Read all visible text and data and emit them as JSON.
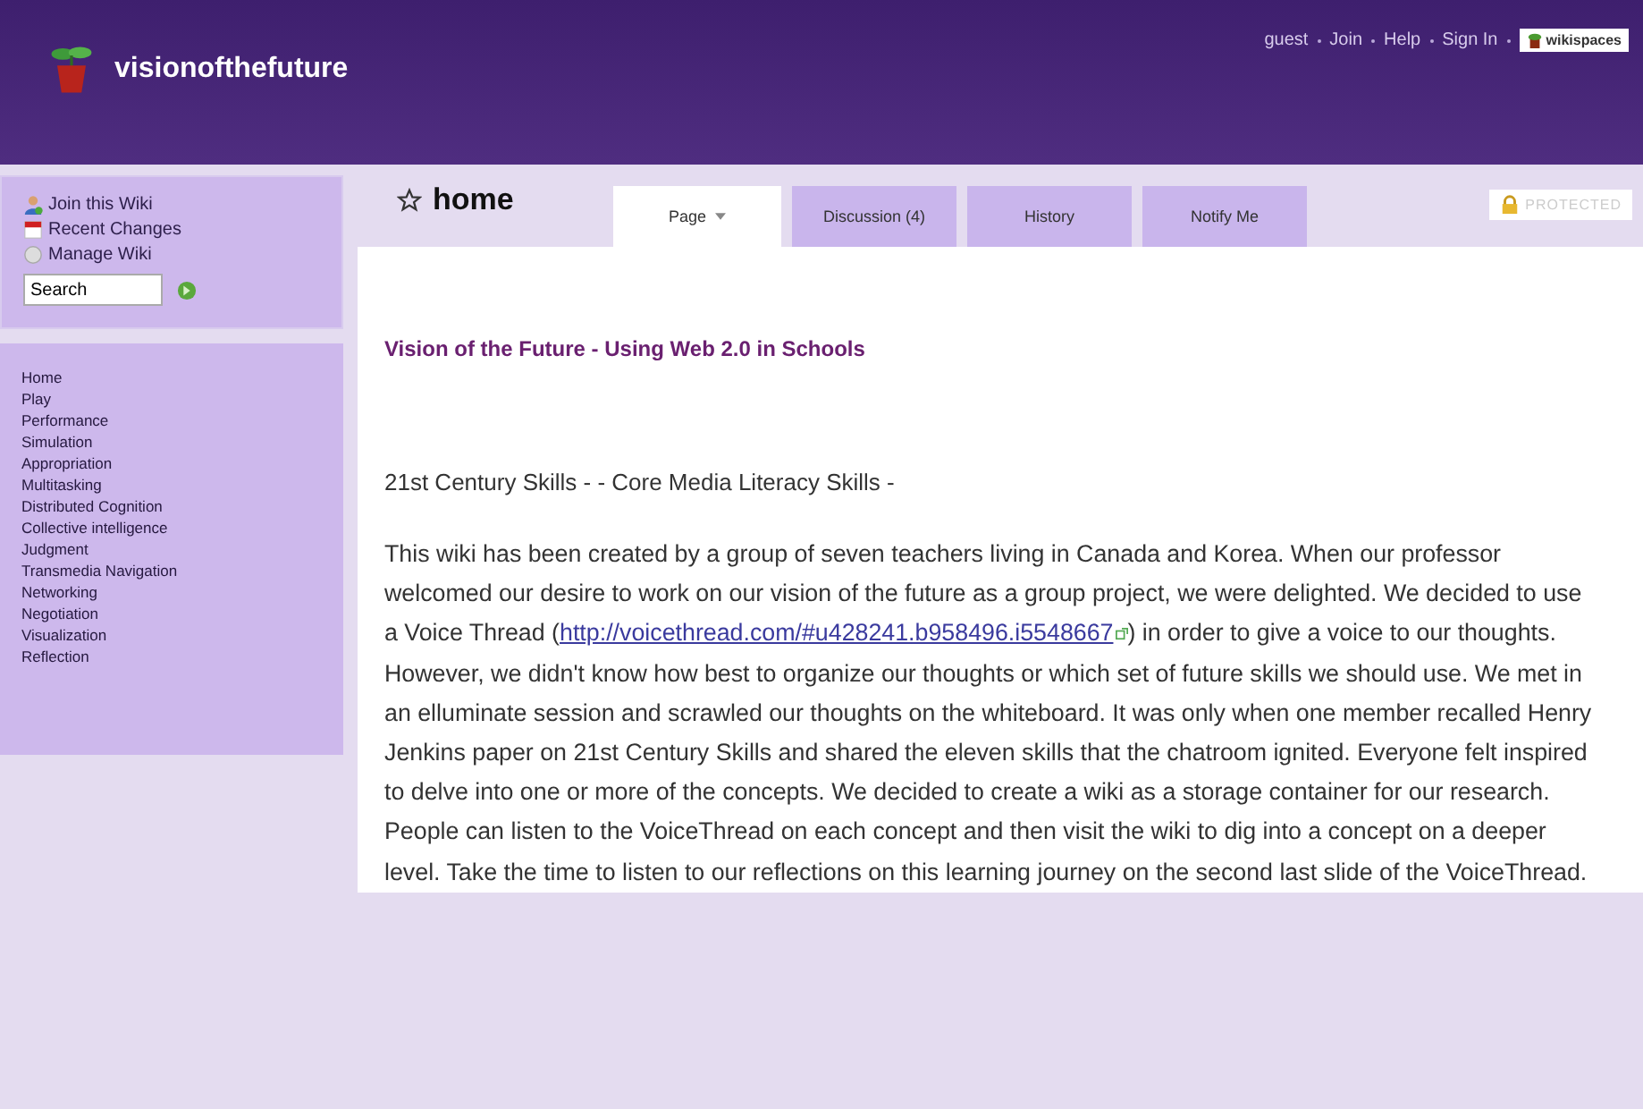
{
  "header": {
    "site_title": "visionofthefuture",
    "user_links": [
      "guest",
      "Join",
      "Help",
      "Sign In"
    ],
    "badge": "wikispaces"
  },
  "sidebar": {
    "actions": [
      {
        "kind": "join",
        "label": "Join this Wiki"
      },
      {
        "kind": "changes",
        "label": "Recent Changes"
      },
      {
        "kind": "manage",
        "label": "Manage Wiki"
      }
    ],
    "search": {
      "value": "Search"
    },
    "nav": [
      "Home",
      "Play",
      "Performance",
      "Simulation",
      "Appropriation",
      "Multitasking",
      "Distributed Cognition",
      "Collective intelligence",
      "Judgment",
      "Transmedia Navigation",
      "Networking",
      "Negotiation",
      "Visualization",
      "Reflection"
    ]
  },
  "page": {
    "title": "home",
    "tabs": [
      {
        "label": "Page",
        "selected": true,
        "dropdown": true
      },
      {
        "label": "Discussion (4)",
        "selected": false,
        "dropdown": false
      },
      {
        "label": "History",
        "selected": false,
        "dropdown": false
      },
      {
        "label": "Notify Me",
        "selected": false,
        "dropdown": false
      }
    ],
    "status": "PROTECTED",
    "heading": "Vision of the Future - Using Web 2.0 in Schools",
    "subheading": "21st Century Skills - - Core Media Literacy Skills -",
    "paragraph": {
      "before": "This wiki has been created by a group of seven teachers living in Canada and Korea. When our professor welcomed our desire to work on our vision of the future as a group project, we were delighted. We decided to use a Voice Thread (",
      "link": "http://voicethread.com/#u428241.b958496.i5548667",
      "after": ") in order to give a voice to our thoughts. However, we didn't know how best to organize our thoughts or which set of future skills we should use. We met in an elluminate session and scrawled our thoughts on the whiteboard. It was only when one member recalled Henry Jenkins paper on 21st Century Skills and shared the eleven skills that the chatroom ignited. Everyone felt inspired to delve into one or more of the concepts. We decided to create a wiki as a storage container for our research. People can listen to the VoiceThread on each concept and then visit the wiki to dig into a concept on a deeper level. Take the time to listen to our reflections on this learning journey on the second last slide of the VoiceThread."
    }
  }
}
